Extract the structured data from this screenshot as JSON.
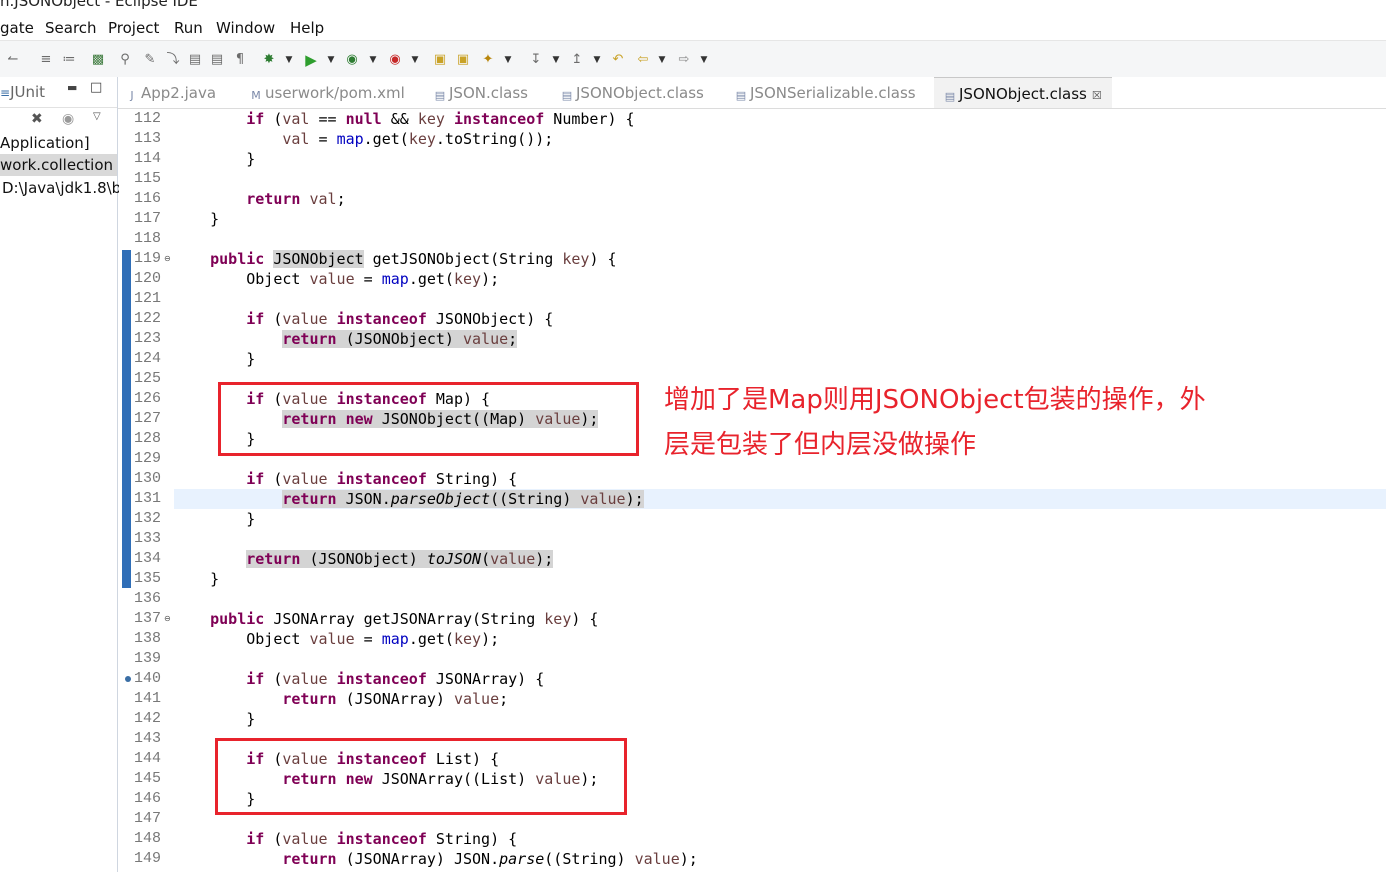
{
  "window": {
    "title": "n.JSONObject - Eclipse IDE"
  },
  "menu": [
    "gate",
    "Search",
    "Project",
    "Run",
    "Window",
    "Help"
  ],
  "left_panel": {
    "title": "JUnit",
    "rows": [
      "Application]",
      "work.collection",
      "D:\\Java\\jdk1.8\\b"
    ],
    "selected_row": 1
  },
  "tabs": [
    {
      "label": "App2.java",
      "icon": "java-file-icon",
      "active": false
    },
    {
      "label": "userwork/pom.xml",
      "icon": "xml-file-icon",
      "active": false
    },
    {
      "label": "JSON.class",
      "icon": "class-file-icon",
      "active": false
    },
    {
      "label": "JSONObject.class",
      "icon": "class-file-icon",
      "active": false
    },
    {
      "label": "JSONSerializable.class",
      "icon": "class-file-icon",
      "active": false
    },
    {
      "label": "JSONObject.class",
      "icon": "class-file-icon",
      "active": true
    }
  ],
  "editor": {
    "current_line": 131,
    "lines": [
      {
        "n": "112",
        "t": [
          [
            "",
            "        "
          ],
          [
            "k",
            "if"
          ],
          [
            "",
            " ("
          ],
          [
            "v",
            "val"
          ],
          [
            "",
            " == "
          ],
          [
            "k",
            "null"
          ],
          [
            "",
            " && "
          ],
          [
            "v",
            "key"
          ],
          [
            "",
            " "
          ],
          [
            "k",
            "instanceof"
          ],
          [
            "",
            " Number) {"
          ]
        ]
      },
      {
        "n": "113",
        "t": [
          [
            "",
            "            "
          ],
          [
            "v",
            "val"
          ],
          [
            "",
            " = "
          ],
          [
            "f",
            "map"
          ],
          [
            "",
            ".get("
          ],
          [
            "v",
            "key"
          ],
          [
            "",
            ".toString());"
          ]
        ]
      },
      {
        "n": "114",
        "t": [
          [
            "",
            "        }"
          ]
        ]
      },
      {
        "n": "115",
        "t": []
      },
      {
        "n": "116",
        "t": [
          [
            "",
            "        "
          ],
          [
            "k",
            "return"
          ],
          [
            "",
            " "
          ],
          [
            "v",
            "val"
          ],
          [
            "",
            ";"
          ]
        ]
      },
      {
        "n": "117",
        "t": [
          [
            "",
            "    }"
          ]
        ]
      },
      {
        "n": "118",
        "t": []
      },
      {
        "n": "119",
        "fold": true,
        "t": [
          [
            "",
            "    "
          ],
          [
            "k",
            "public"
          ],
          [
            "",
            " "
          ],
          [
            "hl",
            "JSONObject"
          ],
          [
            "",
            " getJSONObject(String "
          ],
          [
            "v",
            "key"
          ],
          [
            "",
            ") {"
          ]
        ]
      },
      {
        "n": "120",
        "t": [
          [
            "",
            "        Object "
          ],
          [
            "v",
            "value"
          ],
          [
            "",
            " = "
          ],
          [
            "f",
            "map"
          ],
          [
            "",
            ".get("
          ],
          [
            "v",
            "key"
          ],
          [
            "",
            ");"
          ]
        ]
      },
      {
        "n": "121",
        "t": []
      },
      {
        "n": "122",
        "t": [
          [
            "",
            "        "
          ],
          [
            "k",
            "if"
          ],
          [
            "",
            " ("
          ],
          [
            "v",
            "value"
          ],
          [
            "",
            " "
          ],
          [
            "k",
            "instanceof"
          ],
          [
            "",
            " JSONObject) {"
          ]
        ]
      },
      {
        "n": "123",
        "t": [
          [
            "",
            "            "
          ],
          [
            "hl",
            [
              [
                "k",
                "return"
              ],
              [
                "",
                " (JSONObject) "
              ],
              [
                "v",
                "value"
              ],
              [
                "",
                ";"
              ]
            ]
          ]
        ]
      },
      {
        "n": "124",
        "t": [
          [
            "",
            "        }"
          ]
        ]
      },
      {
        "n": "125",
        "t": []
      },
      {
        "n": "126",
        "t": [
          [
            "",
            "        "
          ],
          [
            "k",
            "if"
          ],
          [
            "",
            " ("
          ],
          [
            "v",
            "value"
          ],
          [
            "",
            " "
          ],
          [
            "k",
            "instanceof"
          ],
          [
            "",
            " Map) {"
          ]
        ]
      },
      {
        "n": "127",
        "t": [
          [
            "",
            "            "
          ],
          [
            "hl",
            [
              [
                "k",
                "return"
              ],
              [
                "",
                " "
              ],
              [
                "k",
                "new"
              ],
              [
                "",
                " JSONObject((Map) "
              ],
              [
                "v",
                "value"
              ],
              [
                "",
                ");"
              ]
            ]
          ]
        ]
      },
      {
        "n": "128",
        "t": [
          [
            "",
            "        }"
          ]
        ]
      },
      {
        "n": "129",
        "t": []
      },
      {
        "n": "130",
        "t": [
          [
            "",
            "        "
          ],
          [
            "k",
            "if"
          ],
          [
            "",
            " ("
          ],
          [
            "v",
            "value"
          ],
          [
            "",
            " "
          ],
          [
            "k",
            "instanceof"
          ],
          [
            "",
            " String) {"
          ]
        ]
      },
      {
        "n": "131",
        "t": [
          [
            "",
            "            "
          ],
          [
            "hl",
            [
              [
                "k",
                "return"
              ],
              [
                "",
                " JSON."
              ],
              [
                "i",
                "parseObject"
              ],
              [
                "",
                "((String) "
              ],
              [
                "v",
                "value"
              ],
              [
                "",
                ");"
              ]
            ]
          ]
        ]
      },
      {
        "n": "132",
        "t": [
          [
            "",
            "        }"
          ]
        ]
      },
      {
        "n": "133",
        "t": []
      },
      {
        "n": "134",
        "t": [
          [
            "",
            "        "
          ],
          [
            "hl",
            [
              [
                "k",
                "return"
              ],
              [
                "",
                " (JSONObject) "
              ],
              [
                "i",
                "toJSON"
              ],
              [
                "",
                "("
              ],
              [
                "v",
                "value"
              ],
              [
                "",
                ");"
              ]
            ]
          ]
        ]
      },
      {
        "n": "135",
        "t": [
          [
            "",
            "    }"
          ]
        ]
      },
      {
        "n": "136",
        "t": []
      },
      {
        "n": "137",
        "fold": true,
        "t": [
          [
            "",
            "    "
          ],
          [
            "k",
            "public"
          ],
          [
            "",
            " JSONArray getJSONArray(String "
          ],
          [
            "v",
            "key"
          ],
          [
            "",
            ") {"
          ]
        ]
      },
      {
        "n": "138",
        "t": [
          [
            "",
            "        Object "
          ],
          [
            "v",
            "value"
          ],
          [
            "",
            " = "
          ],
          [
            "f",
            "map"
          ],
          [
            "",
            ".get("
          ],
          [
            "v",
            "key"
          ],
          [
            "",
            ");"
          ]
        ]
      },
      {
        "n": "139",
        "t": []
      },
      {
        "n": "140",
        "bp": true,
        "t": [
          [
            "",
            "        "
          ],
          [
            "k",
            "if"
          ],
          [
            "",
            " ("
          ],
          [
            "v",
            "value"
          ],
          [
            "",
            " "
          ],
          [
            "k",
            "instanceof"
          ],
          [
            "",
            " JSONArray) {"
          ]
        ]
      },
      {
        "n": "141",
        "t": [
          [
            "",
            "            "
          ],
          [
            "k",
            "return"
          ],
          [
            "",
            " (JSONArray) "
          ],
          [
            "v",
            "value"
          ],
          [
            "",
            ";"
          ]
        ]
      },
      {
        "n": "142",
        "t": [
          [
            "",
            "        }"
          ]
        ]
      },
      {
        "n": "143",
        "t": []
      },
      {
        "n": "144",
        "t": [
          [
            "",
            "        "
          ],
          [
            "k",
            "if"
          ],
          [
            "",
            " ("
          ],
          [
            "v",
            "value"
          ],
          [
            "",
            " "
          ],
          [
            "k",
            "instanceof"
          ],
          [
            "",
            " List) {"
          ]
        ]
      },
      {
        "n": "145",
        "t": [
          [
            "",
            "            "
          ],
          [
            "k",
            "return"
          ],
          [
            "",
            " "
          ],
          [
            "k",
            "new"
          ],
          [
            "",
            " JSONArray((List) "
          ],
          [
            "v",
            "value"
          ],
          [
            "",
            ");"
          ]
        ]
      },
      {
        "n": "146",
        "t": [
          [
            "",
            "        }"
          ]
        ]
      },
      {
        "n": "147",
        "t": []
      },
      {
        "n": "148",
        "t": [
          [
            "",
            "        "
          ],
          [
            "k",
            "if"
          ],
          [
            "",
            " ("
          ],
          [
            "v",
            "value"
          ],
          [
            "",
            " "
          ],
          [
            "k",
            "instanceof"
          ],
          [
            "",
            " String) {"
          ]
        ]
      },
      {
        "n": "149",
        "t": [
          [
            "",
            "            "
          ],
          [
            "k",
            "return"
          ],
          [
            "",
            " (JSONArray) JSON."
          ],
          [
            "i",
            "parse"
          ],
          [
            "",
            "((String) "
          ],
          [
            "v",
            "value"
          ],
          [
            "",
            ");"
          ]
        ]
      }
    ]
  },
  "annotation": {
    "lines": [
      "增加了是Map则用JSONObject包装的操作，外",
      "层是包装了但内层没做操作"
    ],
    "color": "#e8232c"
  }
}
